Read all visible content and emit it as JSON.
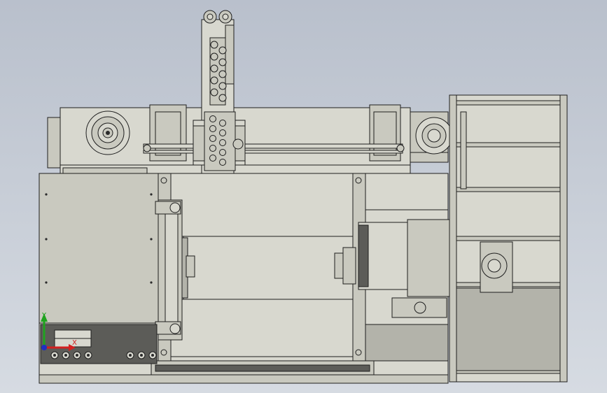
{
  "viewport": {
    "background_top": "#b9c0cc",
    "background_bottom": "#d6dbe2"
  },
  "triad": {
    "y_label": "Y",
    "x_label": "X",
    "y_color": "#1fa31f",
    "x_color": "#d42020",
    "z_color": "#2030c0"
  },
  "colors": {
    "part_fill": "#c9c9bf",
    "part_light": "#d8d8cf",
    "part_dark": "#b3b3aa",
    "panel_dark": "#5c5c58",
    "edge": "#1e1e1e"
  }
}
